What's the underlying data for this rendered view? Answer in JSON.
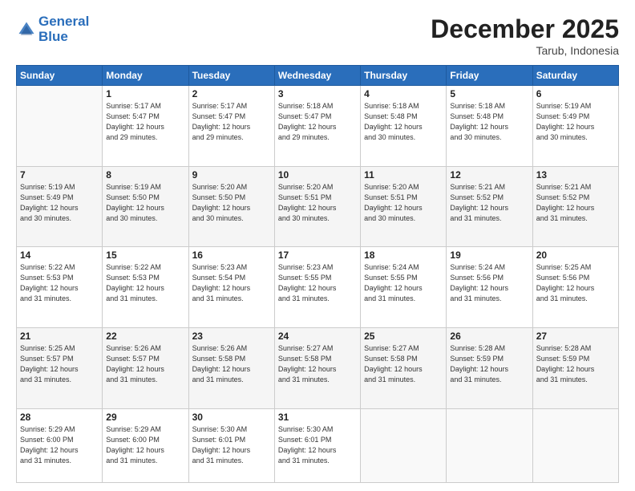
{
  "header": {
    "logo_line1": "General",
    "logo_line2": "Blue",
    "month": "December 2025",
    "location": "Tarub, Indonesia"
  },
  "weekdays": [
    "Sunday",
    "Monday",
    "Tuesday",
    "Wednesday",
    "Thursday",
    "Friday",
    "Saturday"
  ],
  "weeks": [
    [
      {
        "day": "",
        "info": ""
      },
      {
        "day": "1",
        "info": "Sunrise: 5:17 AM\nSunset: 5:47 PM\nDaylight: 12 hours\nand 29 minutes."
      },
      {
        "day": "2",
        "info": "Sunrise: 5:17 AM\nSunset: 5:47 PM\nDaylight: 12 hours\nand 29 minutes."
      },
      {
        "day": "3",
        "info": "Sunrise: 5:18 AM\nSunset: 5:47 PM\nDaylight: 12 hours\nand 29 minutes."
      },
      {
        "day": "4",
        "info": "Sunrise: 5:18 AM\nSunset: 5:48 PM\nDaylight: 12 hours\nand 30 minutes."
      },
      {
        "day": "5",
        "info": "Sunrise: 5:18 AM\nSunset: 5:48 PM\nDaylight: 12 hours\nand 30 minutes."
      },
      {
        "day": "6",
        "info": "Sunrise: 5:19 AM\nSunset: 5:49 PM\nDaylight: 12 hours\nand 30 minutes."
      }
    ],
    [
      {
        "day": "7",
        "info": "Sunrise: 5:19 AM\nSunset: 5:49 PM\nDaylight: 12 hours\nand 30 minutes."
      },
      {
        "day": "8",
        "info": "Sunrise: 5:19 AM\nSunset: 5:50 PM\nDaylight: 12 hours\nand 30 minutes."
      },
      {
        "day": "9",
        "info": "Sunrise: 5:20 AM\nSunset: 5:50 PM\nDaylight: 12 hours\nand 30 minutes."
      },
      {
        "day": "10",
        "info": "Sunrise: 5:20 AM\nSunset: 5:51 PM\nDaylight: 12 hours\nand 30 minutes."
      },
      {
        "day": "11",
        "info": "Sunrise: 5:20 AM\nSunset: 5:51 PM\nDaylight: 12 hours\nand 30 minutes."
      },
      {
        "day": "12",
        "info": "Sunrise: 5:21 AM\nSunset: 5:52 PM\nDaylight: 12 hours\nand 31 minutes."
      },
      {
        "day": "13",
        "info": "Sunrise: 5:21 AM\nSunset: 5:52 PM\nDaylight: 12 hours\nand 31 minutes."
      }
    ],
    [
      {
        "day": "14",
        "info": "Sunrise: 5:22 AM\nSunset: 5:53 PM\nDaylight: 12 hours\nand 31 minutes."
      },
      {
        "day": "15",
        "info": "Sunrise: 5:22 AM\nSunset: 5:53 PM\nDaylight: 12 hours\nand 31 minutes."
      },
      {
        "day": "16",
        "info": "Sunrise: 5:23 AM\nSunset: 5:54 PM\nDaylight: 12 hours\nand 31 minutes."
      },
      {
        "day": "17",
        "info": "Sunrise: 5:23 AM\nSunset: 5:55 PM\nDaylight: 12 hours\nand 31 minutes."
      },
      {
        "day": "18",
        "info": "Sunrise: 5:24 AM\nSunset: 5:55 PM\nDaylight: 12 hours\nand 31 minutes."
      },
      {
        "day": "19",
        "info": "Sunrise: 5:24 AM\nSunset: 5:56 PM\nDaylight: 12 hours\nand 31 minutes."
      },
      {
        "day": "20",
        "info": "Sunrise: 5:25 AM\nSunset: 5:56 PM\nDaylight: 12 hours\nand 31 minutes."
      }
    ],
    [
      {
        "day": "21",
        "info": "Sunrise: 5:25 AM\nSunset: 5:57 PM\nDaylight: 12 hours\nand 31 minutes."
      },
      {
        "day": "22",
        "info": "Sunrise: 5:26 AM\nSunset: 5:57 PM\nDaylight: 12 hours\nand 31 minutes."
      },
      {
        "day": "23",
        "info": "Sunrise: 5:26 AM\nSunset: 5:58 PM\nDaylight: 12 hours\nand 31 minutes."
      },
      {
        "day": "24",
        "info": "Sunrise: 5:27 AM\nSunset: 5:58 PM\nDaylight: 12 hours\nand 31 minutes."
      },
      {
        "day": "25",
        "info": "Sunrise: 5:27 AM\nSunset: 5:58 PM\nDaylight: 12 hours\nand 31 minutes."
      },
      {
        "day": "26",
        "info": "Sunrise: 5:28 AM\nSunset: 5:59 PM\nDaylight: 12 hours\nand 31 minutes."
      },
      {
        "day": "27",
        "info": "Sunrise: 5:28 AM\nSunset: 5:59 PM\nDaylight: 12 hours\nand 31 minutes."
      }
    ],
    [
      {
        "day": "28",
        "info": "Sunrise: 5:29 AM\nSunset: 6:00 PM\nDaylight: 12 hours\nand 31 minutes."
      },
      {
        "day": "29",
        "info": "Sunrise: 5:29 AM\nSunset: 6:00 PM\nDaylight: 12 hours\nand 31 minutes."
      },
      {
        "day": "30",
        "info": "Sunrise: 5:30 AM\nSunset: 6:01 PM\nDaylight: 12 hours\nand 31 minutes."
      },
      {
        "day": "31",
        "info": "Sunrise: 5:30 AM\nSunset: 6:01 PM\nDaylight: 12 hours\nand 31 minutes."
      },
      {
        "day": "",
        "info": ""
      },
      {
        "day": "",
        "info": ""
      },
      {
        "day": "",
        "info": ""
      }
    ]
  ]
}
